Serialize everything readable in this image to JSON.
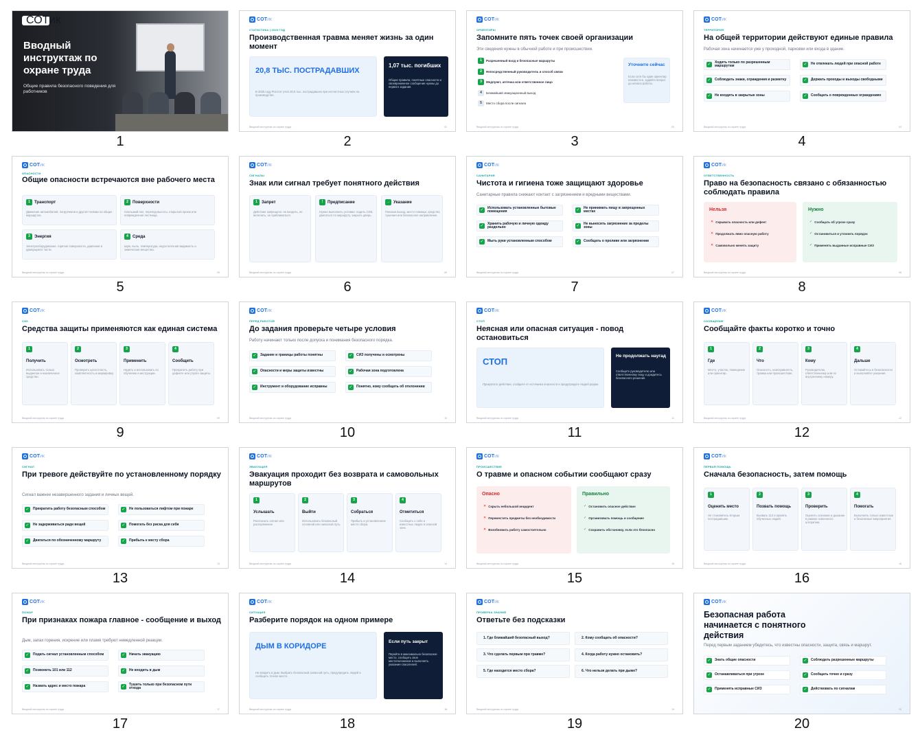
{
  "logo": {
    "text": "СОТ",
    "small": "ИК"
  },
  "footer": "Вводный инструктаж по охране труда",
  "slide_numbers": [
    "1",
    "2",
    "3",
    "4",
    "5",
    "6",
    "7",
    "8",
    "9",
    "10",
    "11",
    "12",
    "13",
    "14",
    "15",
    "16",
    "17",
    "18",
    "19",
    "20"
  ],
  "s1": {
    "title": "Вводный инструктаж по охране труда",
    "subtitle": "Общие правила безопасного поведения для работников"
  },
  "s2": {
    "kicker": "Статистика | 2025 год",
    "title": "Производственная травма меняет жизнь за один момент",
    "big": "20,8 ТЫС. ПОСТРАДАВШИХ",
    "text": "В 2025 году Росстат учел 20,8 тыс. пострадавших при несчастных случаях на производстве.",
    "dark_title": "1,07 тыс. погибших",
    "dark_text": "Общие правила, понятные опасности и своевременное сообщение нужны до первого задания.",
    "pg": "02"
  },
  "s3": {
    "kicker": "Ориентиры",
    "title": "Запомните пять точек своей организации",
    "sub": "Эти сведения нужны в обычной работе и при происшествии.",
    "items": [
      "Разрешенный вход и безопасные маршруты",
      "Непосредственный руководитель и способ связи",
      "Медпункт, аптечка или ответственное лицо",
      "Ближайший эвакуационный выход",
      "Место сбора после сигнала"
    ],
    "side_title": "Уточните сейчас",
    "side_text": "Если хотя бы один ориентир неизвестен, задайте вопрос до начала работы.",
    "pg": "03"
  },
  "s4": {
    "kicker": "Территория",
    "title": "На общей территории действуют единые правила",
    "sub": "Рабочая зона начинается уже у проходной, парковки или входа в здание.",
    "items": [
      "Ходить только по разрешенным маршрутам",
      "Не отвлекать людей при опасной работе",
      "Соблюдать знаки, ограждения и разметку",
      "Держать проходы и выходы свободными",
      "Не входить в закрытые зоны",
      "Сообщать о поврежденных ограждениях"
    ],
    "pg": "04"
  },
  "s5": {
    "kicker": "Опасности",
    "title": "Общие опасности встречаются вне рабочего места",
    "cards": [
      {
        "n": "1",
        "t": "Транспорт",
        "d": "Движение автомобилей, погрузчиков и другой техники на общих маршрутах."
      },
      {
        "n": "2",
        "t": "Поверхности",
        "d": "Скользкий пол, перепад высоты, открытый проем или поврежденная лестница."
      },
      {
        "n": "3",
        "t": "Энергия",
        "d": "Электрооборудование, горячие поверхности, давление и движущиеся части."
      },
      {
        "n": "4",
        "t": "Среда",
        "d": "Шум, пыль, температура, недостаточная видимость и химические вещества."
      }
    ],
    "pg": "05"
  },
  "s6": {
    "kicker": "Сигналы",
    "title": "Знак или сигнал требует понятного действия",
    "cards": [
      {
        "n": "1",
        "t": "Запрет",
        "d": "Действие запрещено: не входить, не включать, не приближаться."
      },
      {
        "n": "!",
        "t": "Предписание",
        "d": "Нужно выполнить условие: надеть СИЗ, двигаться по маршруту, закрыть дверь."
      },
      {
        "n": "→",
        "t": "Указание",
        "d": "Показан выход, место помощи, средство тушения или безопасное направление."
      }
    ],
    "pg": "06"
  },
  "s7": {
    "kicker": "Санитария",
    "title": "Чистота и гигиена тоже защищают здоровье",
    "sub": "Санитарные правила снижают контакт с загрязнением и вредными веществами.",
    "items": [
      "Использовать установленные бытовые помещения",
      "Не принимать пищу в запрещенных местах",
      "Хранить рабочую и личную одежду раздельно",
      "Не выносить загрязнение за пределы зоны",
      "Мыть руки установленным способом",
      "Сообщать о проливе или загрязнении"
    ],
    "pg": "07"
  },
  "s8": {
    "kicker": "Ответственность",
    "title": "Право на безопасность связано с обязанностью соблюдать правила",
    "no_title": "Нельзя",
    "no": [
      "Скрывать опасность или дефект",
      "Продолжать явно опасную работу",
      "Самовольно менять защиту"
    ],
    "yes_title": "Нужно",
    "yes": [
      "Сообщать об угрозе сразу",
      "Остановиться и уточнить порядок",
      "Применять выданные исправные СИЗ"
    ],
    "pg": "08"
  },
  "s9": {
    "kicker": "СИЗ",
    "title": "Средства защиты применяются как единая система",
    "cards": [
      {
        "n": "1",
        "t": "Получить",
        "d": "Использовать только выданное и назначенное средство."
      },
      {
        "n": "2",
        "t": "Осмотреть",
        "d": "Проверить целостность, комплектность и маркировку."
      },
      {
        "n": "3",
        "t": "Применить",
        "d": "Надеть и использовать по обучению и инструкции."
      },
      {
        "n": "4",
        "t": "Сообщить",
        "d": "Прекратить работу при дефекте или утрате защиты."
      }
    ],
    "pg": "09"
  },
  "s10": {
    "kicker": "Перед работой",
    "title": "До задания проверьте четыре условия",
    "sub": "Работу начинают только после допуска и понимания безопасного порядка.",
    "items": [
      "Задание и границы работы понятны",
      "СИЗ получены и осмотрены",
      "Опасности и меры защиты известны",
      "Рабочая зона подготовлена",
      "Инструмент и оборудование исправны",
      "Понятно, кому сообщать об отклонении"
    ],
    "pg": "10"
  },
  "s11": {
    "kicker": "Стоп",
    "title": "Неясная или опасная ситуация - повод остановиться",
    "big": "СТОП",
    "text": "Прекратите действие, отойдите от источника опасности и предупредите людей рядом.",
    "dark_title": "Не продолжать наугад",
    "dark_text": "Сообщите руководителю или ответственному лицу и дождитесь безопасного решения.",
    "pg": "11"
  },
  "s12": {
    "kicker": "Сообщение",
    "title": "Сообщайте факты коротко и точно",
    "cards": [
      {
        "n": "1",
        "t": "Где",
        "d": "Место, участок, помещение или ориентир."
      },
      {
        "n": "2",
        "t": "Что",
        "d": "Опасность, неисправность, травма или происшествие."
      },
      {
        "n": "3",
        "t": "Кому",
        "d": "Руководителю, ответственному или по внутреннему номеру."
      },
      {
        "n": "4",
        "t": "Дальше",
        "d": "Оставайтесь в безопасности и выполняйте указания."
      }
    ],
    "pg": "12"
  },
  "s13": {
    "kicker": "Сигнал",
    "title": "При тревоге действуйте по установленному порядку",
    "sub": "Сигнал важнее незавершенного задания и личных вещей.",
    "items": [
      "Прекратить работу безопасным способом",
      "Не пользоваться лифтом при пожаре",
      "Не задерживаться ради вещей",
      "Помогать без риска для себя",
      "Двигаться по обозначенному маршруту",
      "Прибыть к месту сбора"
    ],
    "pg": "13"
  },
  "s14": {
    "kicker": "Эвакуация",
    "title": "Эвакуация проходит без возврата и самовольных маршрутов",
    "cards": [
      {
        "n": "1",
        "t": "Услышать",
        "d": "Распознать сигнал или распоряжение."
      },
      {
        "n": "2",
        "t": "Выйти",
        "d": "Использовать безопасный основной или запасной путь."
      },
      {
        "n": "3",
        "t": "Собраться",
        "d": "Прибыть в установленное место сбора."
      },
      {
        "n": "4",
        "t": "Отметиться",
        "d": "Сообщить о себе и известных людях в опасной зоне."
      }
    ],
    "pg": "14"
  },
  "s15": {
    "kicker": "Происшествие",
    "title": "О травме и опасном событии сообщают сразу",
    "no_title": "Опасно",
    "no": [
      "Скрыть небольшой инцидент",
      "Переместить предметы без необходимости",
      "Возобновить работу самостоятельно"
    ],
    "yes_title": "Правильно",
    "yes": [
      "Остановить опасное действие",
      "Организовать помощь и сообщение",
      "Сохранить обстановку, если это безопасно"
    ],
    "pg": "15"
  },
  "s16": {
    "kicker": "Первая помощь",
    "title": "Сначала безопасность, затем помощь",
    "cards": [
      {
        "n": "1",
        "t": "Оценить место",
        "d": "Не становитесь вторым пострадавшим."
      },
      {
        "n": "2",
        "t": "Позвать помощь",
        "d": "Вызвать 112 и принять обученных людей."
      },
      {
        "n": "3",
        "t": "Проверить",
        "d": "Оценить сознание и дыхание в рамках освоенного алгоритма."
      },
      {
        "n": "4",
        "t": "Помогать",
        "d": "Выполнять только известные и безопасные мероприятия."
      }
    ],
    "pg": "16"
  },
  "s17": {
    "kicker": "Пожар",
    "title": "При признаках пожара главное - сообщение и выход",
    "sub": "Дым, запах горения, искрение или пламя требуют немедленной реакции.",
    "items": [
      "Подать сигнал установленным способом",
      "Начать эвакуацию",
      "Позвонить 101 или 112",
      "Не входить в дым",
      "Назвать адрес и место пожара",
      "Тушить только при безопасном пути отхода"
    ],
    "pg": "17"
  },
  "s18": {
    "kicker": "Ситуация",
    "title": "Разберите порядок на одном примере",
    "big": "ДЫМ В КОРИДОРЕ",
    "text": "Не входить в дым. Выбрать безопасный запасной путь, предупредить людей и сообщить точное место.",
    "dark_title": "Если путь закрыт",
    "dark_text": "Перейти в максимально безопасное место, сообщить свое местоположение и выполнять указания спасателей.",
    "pg": "18"
  },
  "s19": {
    "kicker": "Проверка знаний",
    "title": "Ответьте без подсказки",
    "items": [
      "1. Где ближайший безопасный выход?",
      "2. Кому сообщать об опасности?",
      "3. Что сделать первым при травме?",
      "4. Когда работу нужно остановить?",
      "5. Где находится место сбора?",
      "6. Что нельзя делать при дыме?"
    ],
    "pg": "19"
  },
  "s20": {
    "title": "Безопасная работа начинается с понятного действия",
    "sub": "Перед первым заданием убедитесь, что известны опасности, защита, связь и маршрут.",
    "items": [
      "Знать общие опасности",
      "Соблюдать разрешенные маршруты",
      "Останавливаться при угрозе",
      "Сообщать точно и сразу",
      "Применять исправные СИЗ",
      "Действовать по сигналам"
    ],
    "pg": "20"
  },
  "icons": {
    "check": "check-icon",
    "cross": "cross-icon",
    "logo": "logo-icon"
  }
}
